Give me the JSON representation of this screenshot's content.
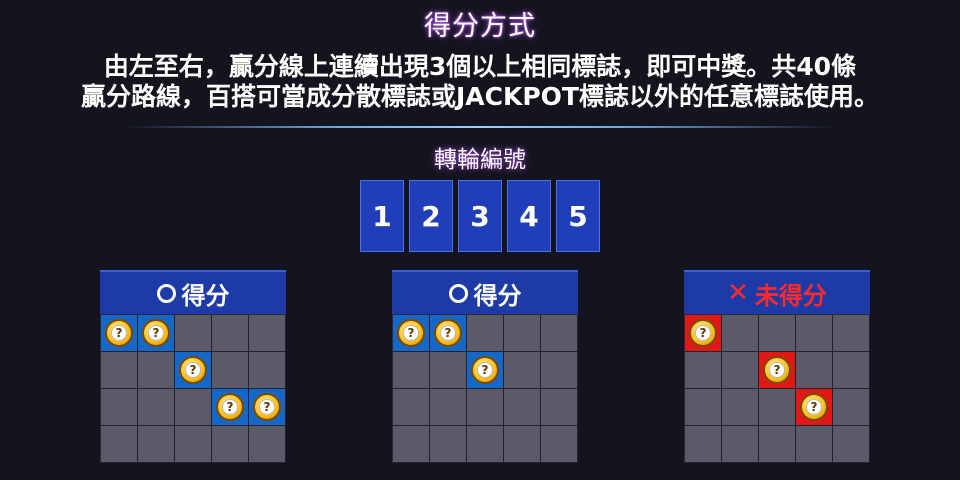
{
  "title": "得分方式",
  "description": [
    "由左至右，贏分線上連續出現3個以上相同標誌，即可中獎。共40條",
    "贏分路線，百搭可當成分散標誌或JACKPOT標誌以外的任意標誌使用。"
  ],
  "reel_section_title": "轉輪編號",
  "reels": [
    "1",
    "2",
    "3",
    "4",
    "5"
  ],
  "coin_symbol": "?",
  "colors": {
    "reel_blue": "#1f3eb8",
    "win_highlight": "#1568c8",
    "lose_highlight": "#e01818",
    "lose_text": "#ff2a2a"
  },
  "examples": [
    {
      "status_icon": "circle-icon",
      "label": "得分",
      "result": "win",
      "coins": [
        [
          0,
          0
        ],
        [
          0,
          1
        ],
        [
          1,
          2
        ],
        [
          2,
          3
        ],
        [
          2,
          4
        ]
      ]
    },
    {
      "status_icon": "circle-icon",
      "label": "得分",
      "result": "win",
      "coins": [
        [
          0,
          0
        ],
        [
          0,
          1
        ],
        [
          1,
          2
        ]
      ]
    },
    {
      "status_icon": "cross-icon",
      "label": "未得分",
      "result": "lose",
      "coins": [
        [
          0,
          0
        ],
        [
          1,
          2
        ],
        [
          2,
          3
        ]
      ]
    }
  ]
}
